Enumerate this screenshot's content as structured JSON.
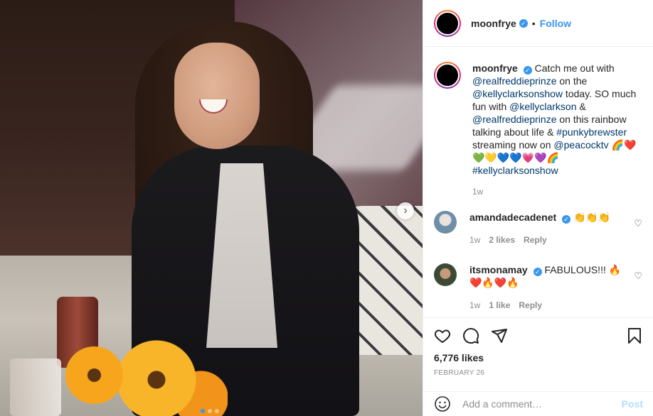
{
  "header": {
    "username": "moonfrye",
    "separator": "•",
    "follow_label": "Follow",
    "more_icon": "more-horizontal-icon"
  },
  "caption": {
    "username": "moonfrye",
    "segments": [
      {
        "text": "Catch me out with ",
        "type": "text"
      },
      {
        "text": "@realfreddieprinze",
        "type": "link"
      },
      {
        "text": " on the ",
        "type": "text"
      },
      {
        "text": "@kellyclarksonshow",
        "type": "link"
      },
      {
        "text": " today. SO much fun with ",
        "type": "text"
      },
      {
        "text": "@kellyclarkson",
        "type": "link"
      },
      {
        "text": " & ",
        "type": "text"
      },
      {
        "text": "@realfreddieprinze",
        "type": "link"
      },
      {
        "text": " on this rainbow talking about life & ",
        "type": "text"
      },
      {
        "text": "#punkybrewster",
        "type": "link"
      },
      {
        "text": " streaming now on ",
        "type": "text"
      },
      {
        "text": "@peacocktv",
        "type": "link"
      },
      {
        "text": " 🌈❤️ 💚💛💙💙💗💜🌈 ",
        "type": "text"
      },
      {
        "text": "#kellyclarksonshow",
        "type": "link"
      }
    ],
    "time": "1w"
  },
  "comments": [
    {
      "username": "amandadecadenet",
      "text": "👏👏👏",
      "time": "1w",
      "likes": "2 likes",
      "reply_label": "Reply"
    },
    {
      "username": "itsmonamay",
      "text": "FABULOUS!!! 🔥 ❤️🔥❤️🔥",
      "time": "1w",
      "likes": "1 like",
      "reply_label": "Reply"
    }
  ],
  "actions": {
    "likes_count": "6,776 likes",
    "date": "FEBRUARY 26"
  },
  "add_comment": {
    "placeholder": "Add a comment…",
    "post_label": "Post"
  },
  "carousel": {
    "slide_count": 3,
    "active_index": 0
  },
  "colors": {
    "accent": "#3897f0",
    "link": "#00376b",
    "muted": "#8e8e8e",
    "post_disabled": "#b2dffc"
  }
}
